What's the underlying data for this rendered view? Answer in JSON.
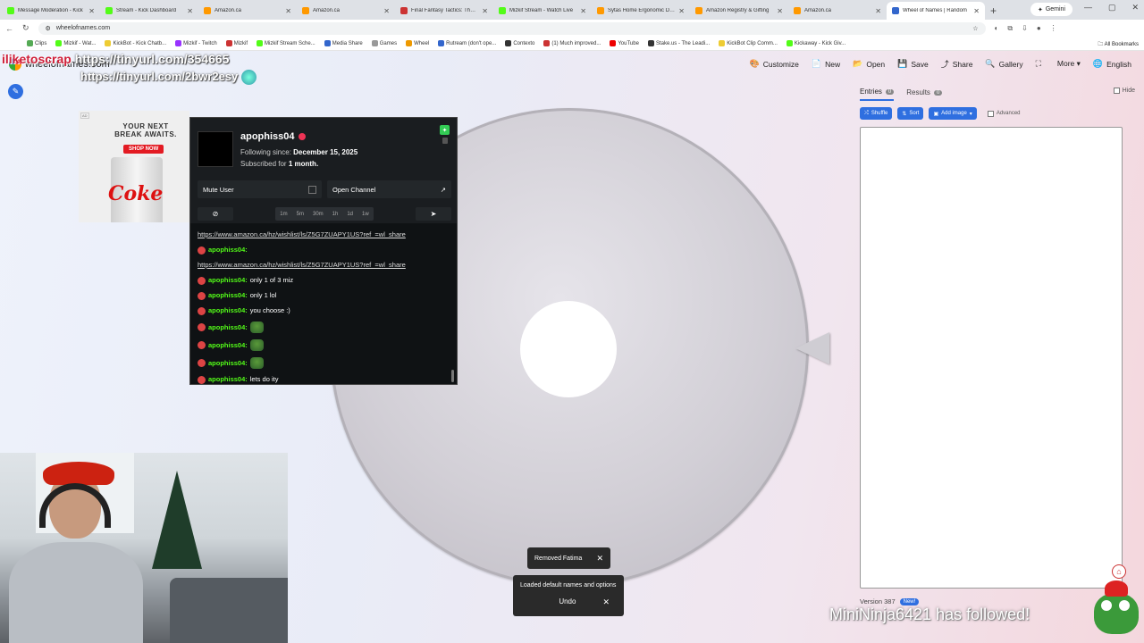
{
  "browser": {
    "tabs": [
      {
        "label": "Message Moderation - Kick",
        "color": "#53fc18",
        "active": false
      },
      {
        "label": "Stream - Kick Dashboard",
        "color": "#53fc18",
        "active": false
      },
      {
        "label": "Amazon.ca",
        "color": "#ff9900",
        "active": false
      },
      {
        "label": "Amazon.ca",
        "color": "#ff9900",
        "active": false
      },
      {
        "label": "Final Fantasy Tactics: The Ivalice",
        "color": "#c33",
        "active": false
      },
      {
        "label": "Mizkif Stream - Watch Live",
        "color": "#53fc18",
        "active": false
      },
      {
        "label": "Sytas Home Ergonomic Desk",
        "color": "#ff9900",
        "active": false
      },
      {
        "label": "Amazon Registry & Gifting",
        "color": "#ff9900",
        "active": false
      },
      {
        "label": "Amazon.ca",
        "color": "#ff9900",
        "active": false
      },
      {
        "label": "Wheel of Names | Random",
        "color": "#36c",
        "active": true
      }
    ],
    "gemini_label": "Gemini",
    "url": "wheelofnames.com",
    "bookmarks": [
      {
        "label": "Clips",
        "color": "#5a5"
      },
      {
        "label": "Mizkif - Wat...",
        "color": "#53fc18"
      },
      {
        "label": "KickBot - Kick Chatb...",
        "color": "#ec3"
      },
      {
        "label": "Mizkif - Twitch",
        "color": "#93f"
      },
      {
        "label": "Mizkif",
        "color": "#c33"
      },
      {
        "label": "Mizkif Stream Sche...",
        "color": "#53fc18"
      },
      {
        "label": "Media Share",
        "color": "#36c"
      },
      {
        "label": "Games",
        "color": "#999"
      },
      {
        "label": "Wheel",
        "color": "#e90"
      },
      {
        "label": "Rutream (don't ope...",
        "color": "#36c"
      },
      {
        "label": "Contexto",
        "color": "#333"
      },
      {
        "label": "(1) Much improved...",
        "color": "#c33"
      },
      {
        "label": "YouTube",
        "color": "#e00"
      },
      {
        "label": "Stake.us - The Leadi...",
        "color": "#333"
      },
      {
        "label": "KickBot Clip Comm...",
        "color": "#ec3"
      },
      {
        "label": "Kickaway - Kick Giv...",
        "color": "#53fc18"
      }
    ],
    "all_bookmarks": "All Bookmarks"
  },
  "site": {
    "logo_text": "wheelofnames.com",
    "menu": [
      {
        "icon": "🎨",
        "label": "Customize"
      },
      {
        "icon": "📄",
        "label": "New"
      },
      {
        "icon": "📂",
        "label": "Open"
      },
      {
        "icon": "💾",
        "label": "Save"
      },
      {
        "icon": "⤴",
        "label": "Share"
      },
      {
        "icon": "🔍",
        "label": "Gallery"
      },
      {
        "icon": "⛶",
        "label": ""
      },
      {
        "icon": "",
        "label": "More ▾"
      },
      {
        "icon": "🌐",
        "label": "English"
      }
    ]
  },
  "panel": {
    "entries_tab": "Entries",
    "entries_count": "0",
    "results_tab": "Results",
    "results_count": "0",
    "hide_label": "Hide",
    "shuffle": "Shuffle",
    "sort": "Sort",
    "add_image": "Add image",
    "advanced": "Advanced",
    "version": "Version 387",
    "new_badge": "New!"
  },
  "toasts": {
    "removed": "Removed Fatima",
    "loaded": "Loaded default names and options",
    "undo": "Undo"
  },
  "ad": {
    "tag": "AD",
    "headline1": "YOUR NEXT",
    "headline2": "BREAK AWAITS.",
    "cta": "SHOP NOW",
    "brand": "Coke"
  },
  "chat": {
    "username": "apophiss04",
    "following_label": "Following since:",
    "following_date": "December 15, 2025",
    "subscribed_label": "Subscribed for",
    "subscribed_value": "1 month.",
    "mute_user": "Mute User",
    "open_channel": "Open Channel",
    "durations": [
      "1m",
      "5m",
      "30m",
      "1h",
      "1d",
      "1w"
    ],
    "messages": [
      {
        "user": "",
        "text": "https://www.amazon.ca/hz/wishlist/ls/Z5G7ZUAPY1US?ref_=wl_share",
        "link": true,
        "emote": false
      },
      {
        "user": "apophiss04:",
        "text": "",
        "link": false,
        "emote": false
      },
      {
        "user": "",
        "text": "https://www.amazon.ca/hz/wishlist/ls/Z5G7ZUAPY1US?ref_=wl_share",
        "link": true,
        "emote": false
      },
      {
        "user": "apophiss04:",
        "text": "only 1 of 3 miz",
        "link": false,
        "emote": false
      },
      {
        "user": "apophiss04:",
        "text": "only 1 lol",
        "link": false,
        "emote": false
      },
      {
        "user": "apophiss04:",
        "text": "you choose :)",
        "link": false,
        "emote": false
      },
      {
        "user": "apophiss04:",
        "text": "",
        "link": false,
        "emote": true
      },
      {
        "user": "apophiss04:",
        "text": "",
        "link": false,
        "emote": true
      },
      {
        "user": "apophiss04:",
        "text": "",
        "link": false,
        "emote": true
      },
      {
        "user": "apophiss04:",
        "text": "lets do ity",
        "link": false,
        "emote": false
      }
    ]
  },
  "overlay": {
    "line1_user": "iliketoscrap",
    "line1_text": "https://tinyurl.com/354665",
    "line2_text": "https://tinyurl.com/2bwr2esy",
    "follow_alert": "MiniNinja6421 has followed!"
  }
}
